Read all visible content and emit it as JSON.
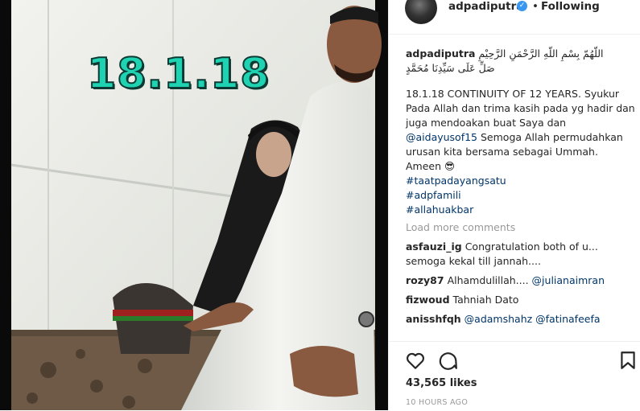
{
  "photo": {
    "overlay_text": "18.1.18"
  },
  "header": {
    "username": "adpadiputra",
    "verified_icon": "check-icon",
    "follow_status": "Following",
    "separator": "•"
  },
  "caption": {
    "username": "adpadiputra",
    "arabic_line1": "اللّهُمّ بِسْمِ اللّهِ الرَّحْمَنِ الرَّحِيْمِ",
    "arabic_line2": "صَلِّ عَلَى سَيِّدِنَا مُحَمَّدٍ",
    "body": "18.1.18 CONTINUITY OF 12 YEARS. Syukur Pada Allah dan trima kasih pada yg hadir dan juga mendoakan buat Saya dan",
    "mention": "@aidayusof15",
    "body2": " Semoga Allah permudahkan urusan kita bersama sebagai Ummah. Ameen 😎",
    "hashtags": [
      "#taatpadayangsatu",
      "#adpfamili",
      "#allahuakbar"
    ]
  },
  "load_more": "Load more comments",
  "comments": [
    {
      "user": "asfauzi_ig",
      "text": "Congratulation both of u... semoga kekal till jannah...."
    },
    {
      "user": "rozy87",
      "text": "Alhamdulillah.... ",
      "mention": "@julianaimran"
    },
    {
      "user": "fizwoud",
      "text": "Tahniah Dato"
    },
    {
      "user": "anisshfqh",
      "text": "",
      "mention": "@adamshahz @fatinafeefa"
    }
  ],
  "actions": {
    "like_icon": "heart-icon",
    "comment_icon": "comment-icon",
    "save_icon": "bookmark-icon"
  },
  "likes": "43,565 likes",
  "timestamp": "10 HOURS AGO"
}
